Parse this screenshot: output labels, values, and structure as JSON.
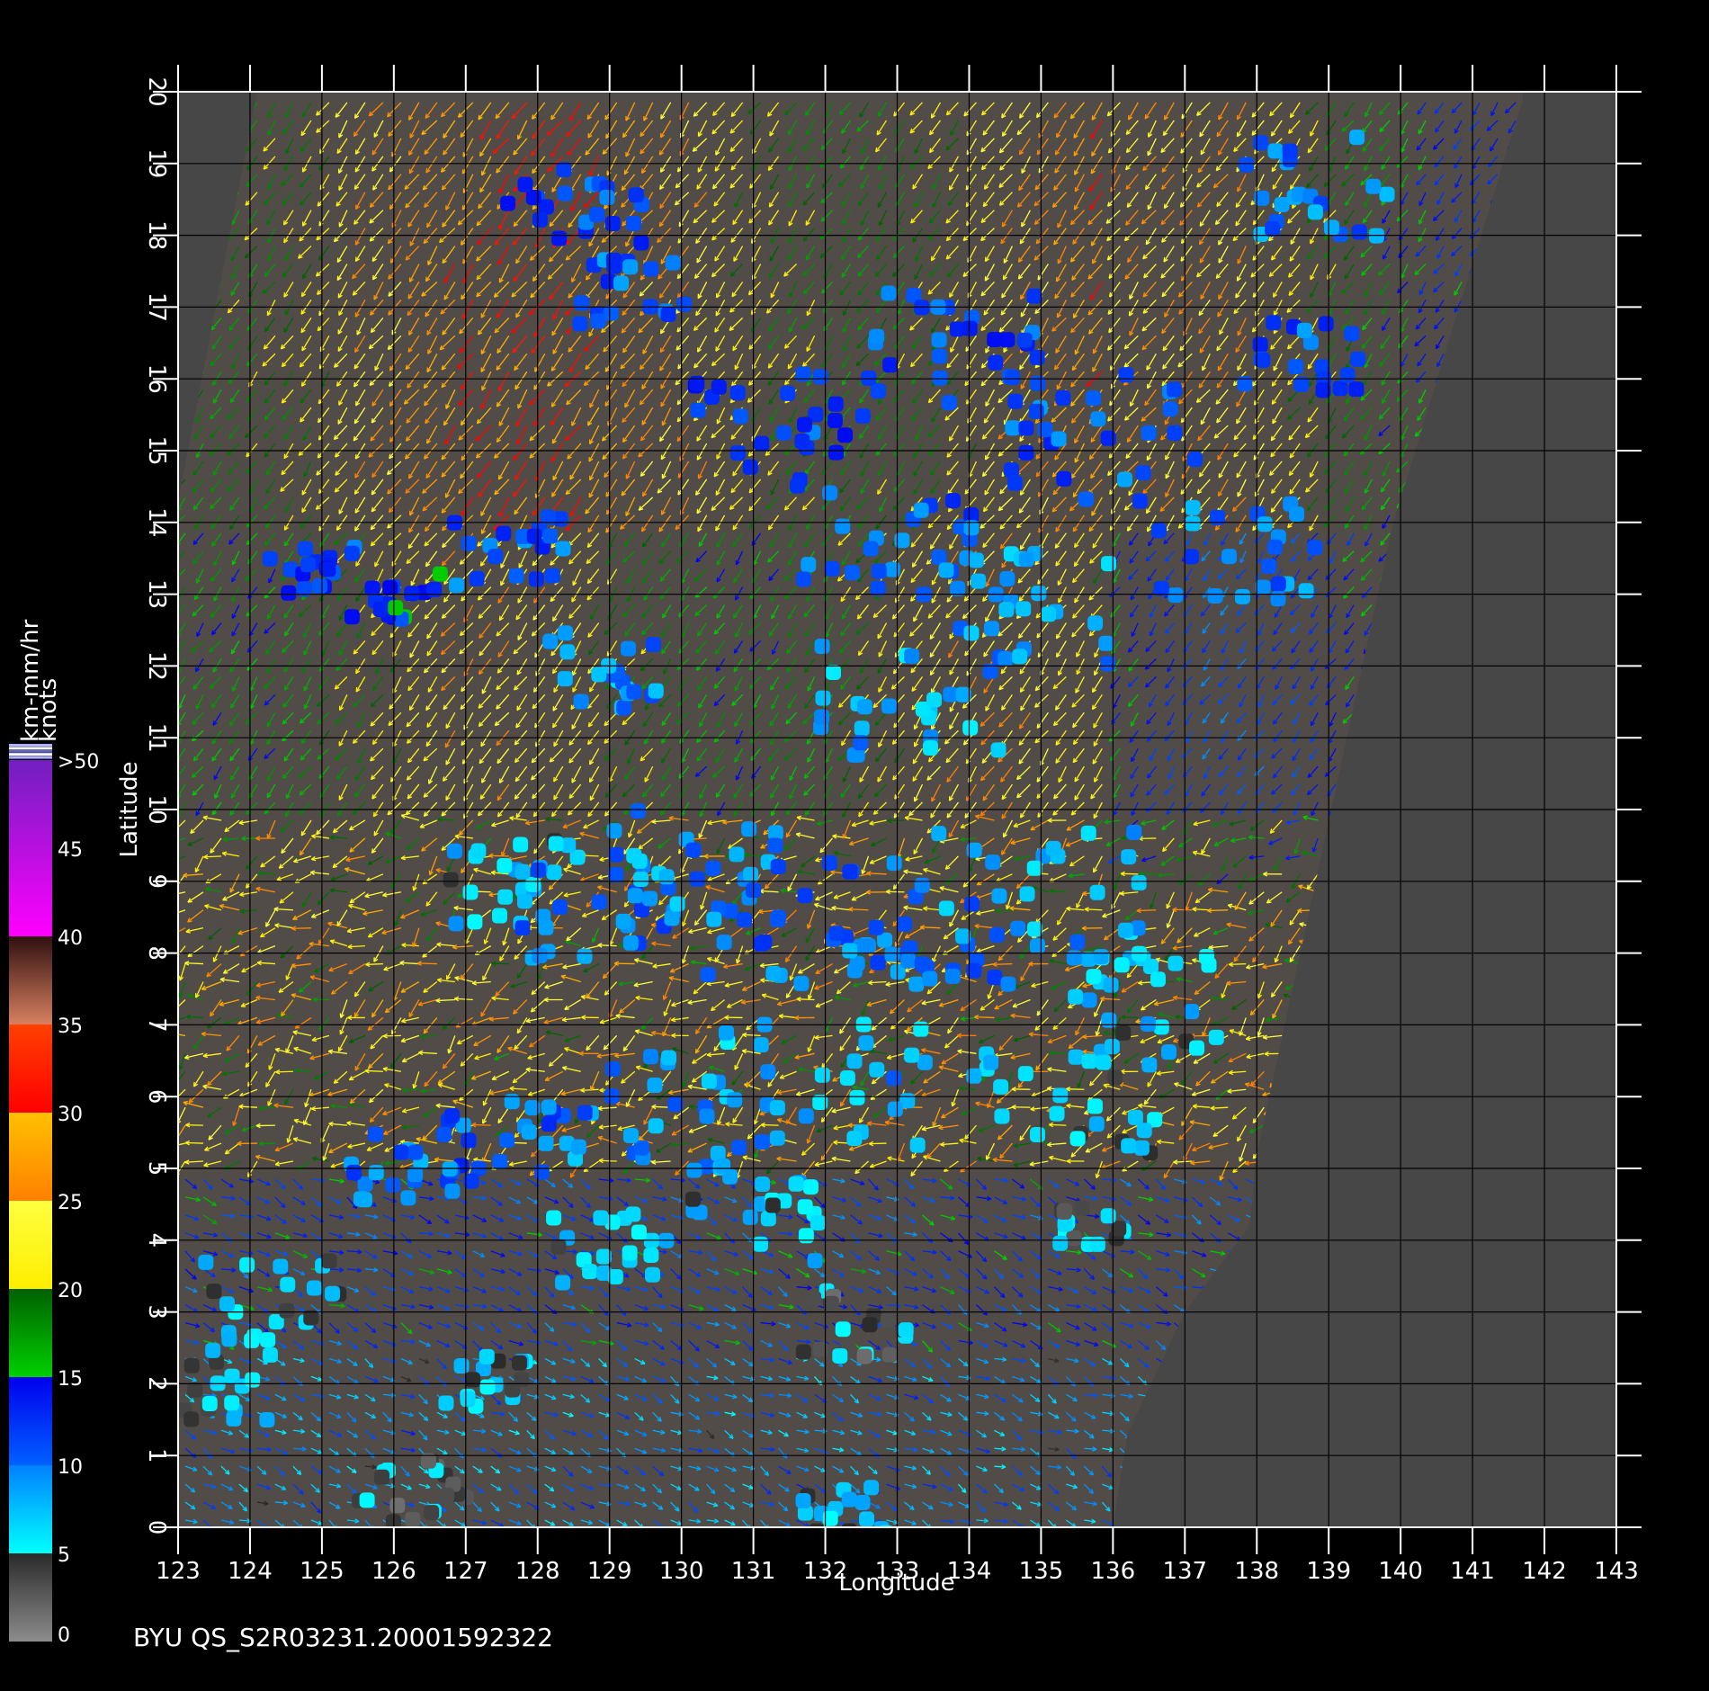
{
  "chart_data": {
    "type": "scatter",
    "subtype": "wind-vector-field",
    "title": "BYU  QS_S2R03231.20001592322",
    "xlabel": "Longitude",
    "ylabel": "Latitude",
    "xlim": [
      123,
      143
    ],
    "ylim": [
      0,
      20
    ],
    "xticks": [
      123,
      124,
      125,
      126,
      127,
      128,
      129,
      130,
      131,
      132,
      133,
      134,
      135,
      136,
      137,
      138,
      139,
      140,
      141,
      142,
      143
    ],
    "yticks": [
      0,
      1,
      2,
      3,
      4,
      5,
      6,
      7,
      8,
      9,
      10,
      11,
      12,
      13,
      14,
      15,
      16,
      17,
      18,
      19,
      20
    ],
    "grid": true,
    "background": "#474747",
    "colorbar": {
      "unit_top": "km-mm/hr",
      "unit_bottom": "knots",
      "ticks": [
        "0",
        "5",
        "10",
        "15",
        "20",
        "25",
        "30",
        "35",
        "40",
        "45",
        ">50"
      ],
      "bands": [
        {
          "from": 0,
          "to": 5,
          "color_low": "#8c8c8c",
          "color_high": "#2a2a2a"
        },
        {
          "from": 5,
          "to": 10,
          "color_low": "#00ffff",
          "color_high": "#0080ff"
        },
        {
          "from": 10,
          "to": 15,
          "color_low": "#0060ff",
          "color_high": "#0000ee"
        },
        {
          "from": 15,
          "to": 20,
          "color_low": "#00d000",
          "color_high": "#006000"
        },
        {
          "from": 20,
          "to": 25,
          "color_low": "#ffee00",
          "color_high": "#ffff40"
        },
        {
          "from": 25,
          "to": 30,
          "color_low": "#ff8000",
          "color_high": "#ffc000"
        },
        {
          "from": 30,
          "to": 35,
          "color_low": "#ff0000",
          "color_high": "#ff4000"
        },
        {
          "from": 35,
          "to": 40,
          "color_low": "#d88060",
          "color_high": "#301010"
        },
        {
          "from": 40,
          "to": 50,
          "color_low": "#ff00ff",
          "color_high": "#7020c0"
        }
      ]
    },
    "swath_polygon": [
      [
        123,
        14.3
      ],
      [
        124.1,
        20
      ],
      [
        141.7,
        20
      ],
      [
        141.7,
        19.9
      ],
      [
        139.9,
        14
      ],
      [
        138,
        5.2
      ],
      [
        137.9,
        4.2
      ],
      [
        137,
        3
      ],
      [
        136.2,
        1.3
      ],
      [
        136,
        0
      ],
      [
        123,
        0
      ]
    ],
    "rain_flag_clusters": [
      {
        "lon": 124.9,
        "lat": 13.4,
        "spread": 0.4,
        "rain": 12
      },
      {
        "lon": 126.0,
        "lat": 12.9,
        "spread": 0.4,
        "rain": 13
      },
      {
        "lon": 127.6,
        "lat": 13.6,
        "spread": 0.5,
        "rain": 11
      },
      {
        "lon": 128.5,
        "lat": 18.5,
        "spread": 0.6,
        "rain": 12
      },
      {
        "lon": 128.7,
        "lat": 11.9,
        "spread": 0.6,
        "rain": 9
      },
      {
        "lon": 129.3,
        "lat": 17.2,
        "spread": 0.5,
        "rain": 11
      },
      {
        "lon": 131.2,
        "lat": 15.4,
        "spread": 0.7,
        "rain": 12
      },
      {
        "lon": 132.8,
        "lat": 13.8,
        "spread": 0.8,
        "rain": 11
      },
      {
        "lon": 133.2,
        "lat": 11.5,
        "spread": 0.8,
        "rain": 8
      },
      {
        "lon": 133.8,
        "lat": 16.3,
        "spread": 0.9,
        "rain": 12
      },
      {
        "lon": 134.7,
        "lat": 12.8,
        "spread": 0.8,
        "rain": 8
      },
      {
        "lon": 135.7,
        "lat": 15.2,
        "spread": 0.9,
        "rain": 11
      },
      {
        "lon": 137.7,
        "lat": 13.6,
        "spread": 0.7,
        "rain": 10
      },
      {
        "lon": 138.6,
        "lat": 16.3,
        "spread": 0.5,
        "rain": 11
      },
      {
        "lon": 138.9,
        "lat": 18.7,
        "spread": 0.7,
        "rain": 10
      },
      {
        "lon": 127.6,
        "lat": 9.0,
        "spread": 0.6,
        "rain": 7
      },
      {
        "lon": 128.8,
        "lat": 8.6,
        "spread": 0.7,
        "rain": 10
      },
      {
        "lon": 130.3,
        "lat": 9.2,
        "spread": 0.8,
        "rain": 9
      },
      {
        "lon": 131.8,
        "lat": 8.4,
        "spread": 0.9,
        "rain": 10
      },
      {
        "lon": 133.4,
        "lat": 8.2,
        "spread": 0.8,
        "rain": 10
      },
      {
        "lon": 135.0,
        "lat": 8.8,
        "spread": 0.9,
        "rain": 8
      },
      {
        "lon": 136.4,
        "lat": 7.3,
        "spread": 0.7,
        "rain": 7
      },
      {
        "lon": 135.3,
        "lat": 6.0,
        "spread": 0.8,
        "rain": 6
      },
      {
        "lon": 132.0,
        "lat": 6.2,
        "spread": 0.9,
        "rain": 8
      },
      {
        "lon": 129.6,
        "lat": 5.8,
        "spread": 0.8,
        "rain": 9
      },
      {
        "lon": 127.7,
        "lat": 5.4,
        "spread": 0.6,
        "rain": 11
      },
      {
        "lon": 126.2,
        "lat": 5.0,
        "spread": 0.5,
        "rain": 10
      },
      {
        "lon": 130.8,
        "lat": 4.4,
        "spread": 0.7,
        "rain": 7
      },
      {
        "lon": 128.9,
        "lat": 3.9,
        "spread": 0.5,
        "rain": 6
      },
      {
        "lon": 124.3,
        "lat": 3.2,
        "spread": 0.6,
        "rain": 6
      },
      {
        "lon": 123.5,
        "lat": 2.0,
        "spread": 0.5,
        "rain": 6
      },
      {
        "lon": 127.3,
        "lat": 2.0,
        "spread": 0.4,
        "rain": 6
      },
      {
        "lon": 132.4,
        "lat": 2.8,
        "spread": 0.5,
        "rain": 4
      },
      {
        "lon": 135.7,
        "lat": 4.2,
        "spread": 0.3,
        "rain": 5
      },
      {
        "lon": 126.3,
        "lat": 0.5,
        "spread": 0.5,
        "rain": 4
      },
      {
        "lon": 132.2,
        "lat": 0.2,
        "spread": 0.4,
        "rain": 7
      }
    ]
  }
}
